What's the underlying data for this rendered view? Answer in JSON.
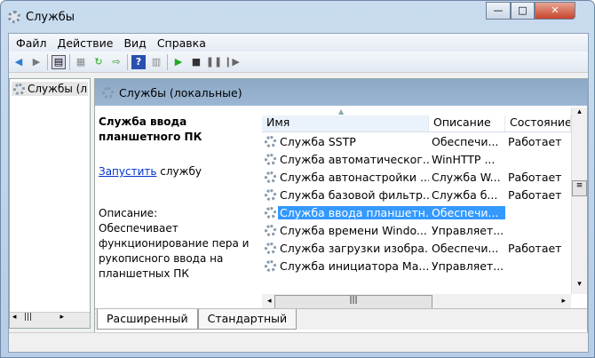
{
  "window": {
    "title": "Службы",
    "minimize": "—",
    "maximize": "□",
    "close": "✕"
  },
  "menu": [
    "Файл",
    "Действие",
    "Вид",
    "Справка"
  ],
  "tree": {
    "item": "Службы (л"
  },
  "panel": {
    "header": "Службы (локальные)"
  },
  "detail": {
    "title": "Служба ввода планшетного ПК",
    "action_link": "Запустить",
    "action_rest": " службу",
    "desc_label": "Описание:",
    "desc_text": "Обеспечивает функционирование пера и рукописного ввода на планшетных ПК"
  },
  "columns": [
    "Имя",
    "Описание",
    "Состояние"
  ],
  "rows": [
    {
      "name": "Служба SSTP",
      "desc": "Обеспечи...",
      "state": "Работает"
    },
    {
      "name": "Служба автоматическог...",
      "desc": "WinHTTP ...",
      "state": ""
    },
    {
      "name": "Служба автонастройки ...",
      "desc": "Служба W...",
      "state": "Работает"
    },
    {
      "name": "Служба базовой фильтр...",
      "desc": "Служба б...",
      "state": "Работает"
    },
    {
      "name": "Служба ввода планшетн...",
      "desc": "Обеспечи...",
      "state": "",
      "selected": true
    },
    {
      "name": "Служба времени Windo...",
      "desc": "Управляет...",
      "state": ""
    },
    {
      "name": "Служба загрузки изобра...",
      "desc": "Обеспечи...",
      "state": "Работает"
    },
    {
      "name": "Служба инициатора Ма...",
      "desc": "Управляет...",
      "state": ""
    }
  ],
  "tabs": [
    "Расширенный",
    "Стандартный"
  ]
}
